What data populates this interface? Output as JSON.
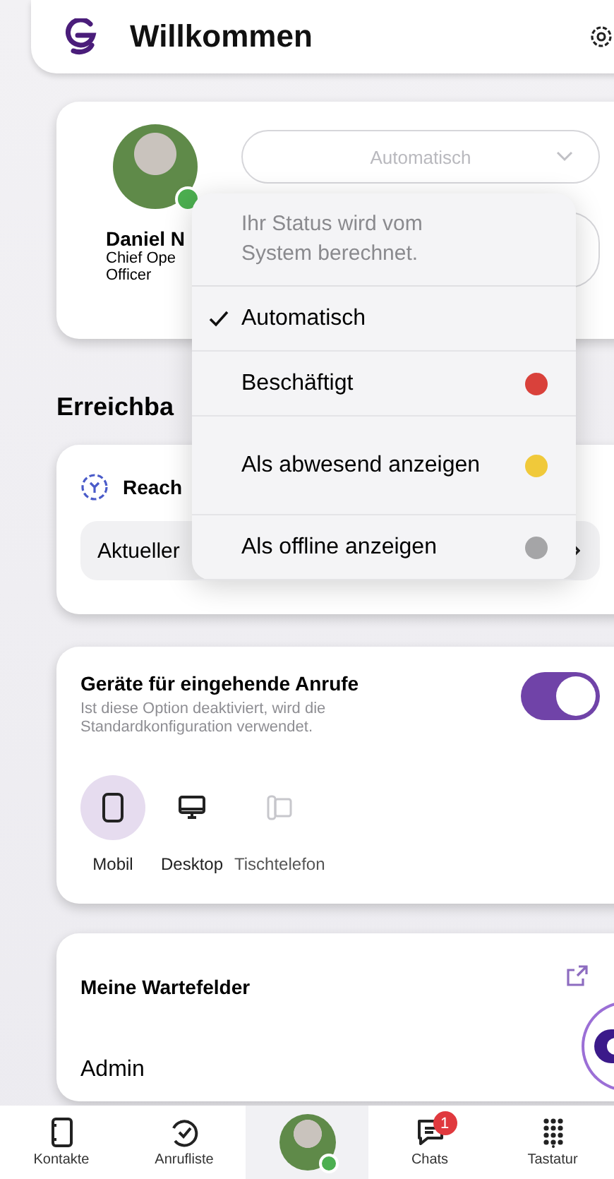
{
  "header": {
    "title": "Willkommen"
  },
  "profile": {
    "name": "Daniel N",
    "role_lines": [
      "Chief Ope",
      "Officer"
    ],
    "status_select": {
      "value": "Automatisch"
    }
  },
  "status_menu": {
    "info": "Ihr Status wird vom System berechnet.",
    "options": [
      {
        "label": "Automatisch",
        "selected": true
      },
      {
        "label": "Beschäftigt",
        "selected": false,
        "color": "#d9413b"
      },
      {
        "label": "Als abwesend anzeigen",
        "selected": false,
        "color": "#f0c93a"
      },
      {
        "label": "Als offline anzeigen",
        "selected": false,
        "color": "#a5a5a7"
      }
    ]
  },
  "section_title": "Erreichba",
  "reach_card": {
    "title": "Reach",
    "row": "Aktueller"
  },
  "devices_card": {
    "title": "Geräte für eingehende Anrufe",
    "description": "Ist diese Option deaktiviert, wird die Standardkonfiguration verwendet.",
    "on": true,
    "devices": [
      {
        "kind": "mobile",
        "label": "Mobil",
        "selected": true,
        "disabled": false
      },
      {
        "kind": "desktop",
        "label": "Desktop",
        "selected": false,
        "disabled": false
      },
      {
        "kind": "deskphone",
        "label": "Tischtelefon",
        "selected": false,
        "disabled": true
      }
    ]
  },
  "queues_card": {
    "title": "Meine Wartefelder",
    "item": "Admin"
  },
  "tabbar": [
    {
      "kind": "contacts",
      "label": "Kontakte",
      "selected": false
    },
    {
      "kind": "calls",
      "label": "Anrufliste",
      "selected": false
    },
    {
      "kind": "me",
      "selected": true
    },
    {
      "kind": "chats",
      "label": "Chats",
      "selected": false,
      "badge": "1"
    },
    {
      "kind": "keypad",
      "label": "Tastatur",
      "selected": false
    }
  ]
}
